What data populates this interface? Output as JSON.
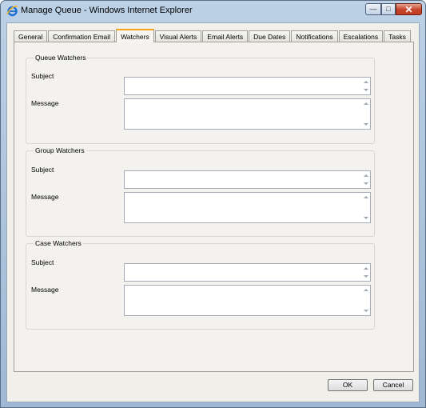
{
  "window": {
    "title": "Manage Queue - Windows Internet Explorer",
    "icon": "ie-icon",
    "controls": {
      "minimize": "minimize-icon",
      "maximize": "maximize-icon",
      "close": "close-icon"
    }
  },
  "tabs": [
    {
      "label": "General",
      "active": false
    },
    {
      "label": "Confirmation Email",
      "active": false
    },
    {
      "label": "Watchers",
      "active": true
    },
    {
      "label": "Visual Alerts",
      "active": false
    },
    {
      "label": "Email Alerts",
      "active": false
    },
    {
      "label": "Due Dates",
      "active": false
    },
    {
      "label": "Notifications",
      "active": false
    },
    {
      "label": "Escalations",
      "active": false
    },
    {
      "label": "Tasks",
      "active": false
    }
  ],
  "groups": [
    {
      "title": "Queue Watchers",
      "subject_label": "Subject",
      "subject_value": "",
      "message_label": "Message",
      "message_value": ""
    },
    {
      "title": "Group Watchers",
      "subject_label": "Subject",
      "subject_value": "",
      "message_label": "Message",
      "message_value": ""
    },
    {
      "title": "Case Watchers",
      "subject_label": "Subject",
      "subject_value": "",
      "message_label": "Message",
      "message_value": ""
    }
  ],
  "buttons": {
    "ok": "OK",
    "cancel": "Cancel"
  },
  "colors": {
    "active_tab_accent": "#f2a51b",
    "close_button": "#c4442a",
    "panel_background": "#f3f2ee"
  }
}
